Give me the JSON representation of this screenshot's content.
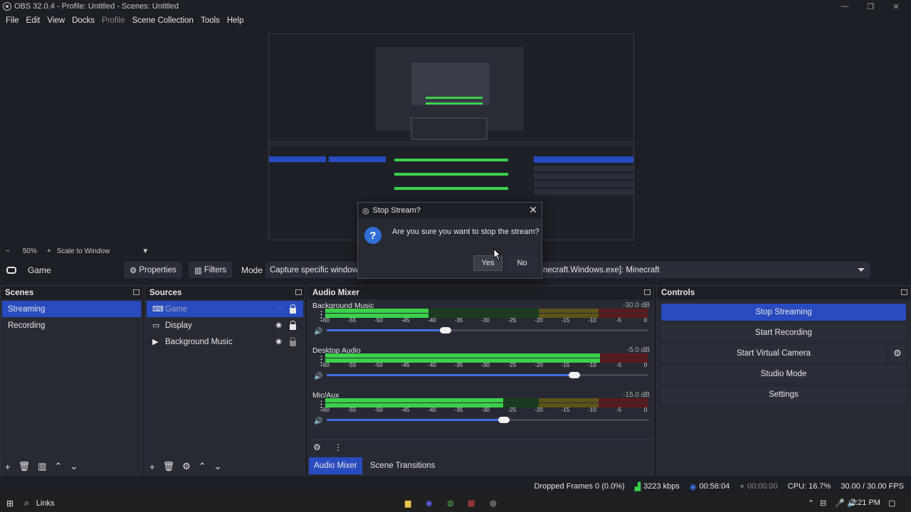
{
  "window": {
    "title": "OBS 32.0.4 - Profile: Untitled - Scenes: Untitled"
  },
  "menu": [
    "File",
    "Edit",
    "View",
    "Docks",
    "Profile",
    "Scene Collection",
    "Tools",
    "Help"
  ],
  "preview_bar": {
    "minus": "−",
    "zoom": "50%",
    "plus": "+",
    "scale": "Scale to Window"
  },
  "source_bar": {
    "source_name": "Game",
    "properties": "Properties",
    "filters": "Filters",
    "mode_label": "Mode",
    "mode_value": "Capture specific window",
    "window_value": "necraft.Windows.exe]: Minecraft"
  },
  "scenes": {
    "title": "Scenes",
    "items": [
      "Streaming",
      "Recording"
    ]
  },
  "sources": {
    "title": "Sources",
    "items": [
      "Game",
      "Display",
      "Background Music"
    ]
  },
  "mixer": {
    "title": "Audio Mixer",
    "channels": [
      {
        "name": "Background Music",
        "db": "-30.0 dB",
        "level": 0.32,
        "volume": 0.37
      },
      {
        "name": "Desktop Audio",
        "db": "-5.0 dB",
        "level": 0.85,
        "volume": 0.77
      },
      {
        "name": "Mic/Aux",
        "db": "-15.0 dB",
        "level": 0.55,
        "volume": 0.55
      }
    ],
    "scale": [
      "-60",
      "-55",
      "-50",
      "-45",
      "-40",
      "-35",
      "-30",
      "-25",
      "-20",
      "-15",
      "-10",
      "-5",
      "0"
    ]
  },
  "controls": {
    "title": "Controls",
    "stop_streaming": "Stop Streaming",
    "start_recording": "Start Recording",
    "start_virtual_camera": "Start Virtual Camera",
    "studio_mode": "Studio Mode",
    "settings": "Settings"
  },
  "tabs": {
    "mixer": "Audio Mixer",
    "transitions": "Scene Transitions"
  },
  "status": {
    "dropped": "Dropped Frames 0 (0.0%)",
    "kbps": "3223 kbps",
    "stream_time": "00:56:04",
    "rec_time": "00:00:00",
    "cpu": "CPU: 16.7%",
    "fps": "30.00 / 30.00 FPS"
  },
  "taskbar": {
    "links": "Links",
    "time": "2:21 PM"
  },
  "dialog": {
    "title": "Stop Stream?",
    "message": "Are you sure you want to stop the stream?",
    "yes": "Yes",
    "no": "No"
  },
  "colors": {
    "accent": "#284bbf",
    "meter_green": "#3bd14a",
    "background": "#1d1f26"
  }
}
